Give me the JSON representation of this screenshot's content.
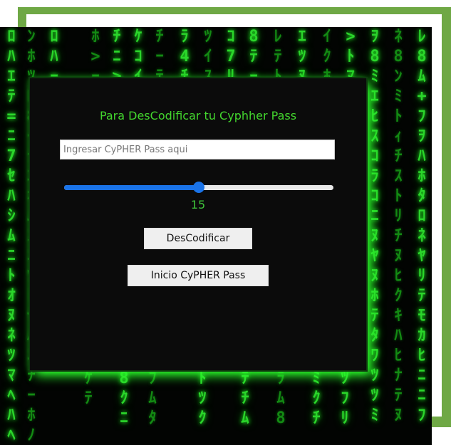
{
  "panel": {
    "title": "Para DesCodificar tu Cyphher Pass",
    "input": {
      "placeholder": "Ingresar CyPHER Pass aqui",
      "value": ""
    },
    "slider": {
      "value": 15,
      "min": 0,
      "max": 30
    },
    "decode_button_label": "DesCodificar",
    "home_button_label": "Inicio CyPHER Pass"
  },
  "colors": {
    "accent": "#1a73e8",
    "title_green": "#43d62e",
    "frame_green": "#6fa845",
    "matrix_green": "#2bd62b"
  }
}
